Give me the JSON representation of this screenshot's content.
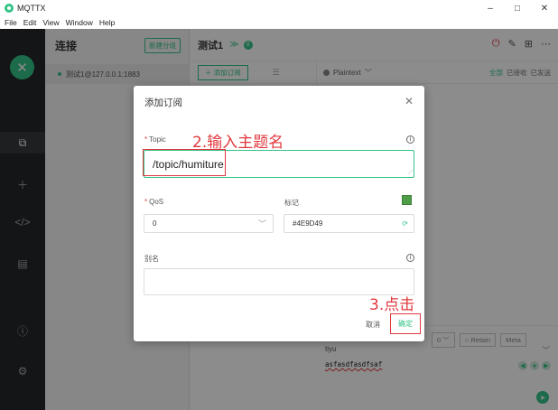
{
  "window": {
    "title": "MQTTX",
    "controls": [
      "–",
      "□",
      "✕"
    ]
  },
  "menu": [
    "File",
    "Edit",
    "View",
    "Window",
    "Help"
  ],
  "sidebar": {
    "logo_text": "✕",
    "nav_icons": [
      "copy-icon",
      "plus-icon",
      "code-icon",
      "log-icon",
      "info-icon",
      "settings-icon"
    ]
  },
  "connections": {
    "title": "连接",
    "new_group": "新建分组",
    "items": [
      {
        "label": "测试1@127.0.0.1:1883"
      }
    ]
  },
  "main": {
    "name": "测试1",
    "badge": "0",
    "add_subscription": "＋ 添加订阅",
    "payload_format": "Plaintext",
    "filters": [
      "全部",
      "已接收",
      "已发送"
    ],
    "qos_value": "0",
    "retain": "Retain",
    "meta": "Meta",
    "compose_topic": "tiyu",
    "compose_payload": "asfasdfasdfsaf"
  },
  "dialog": {
    "title": "添加订阅",
    "topic_label": "Topic",
    "topic_value": "/topic/humiture",
    "qos_label": "QoS",
    "qos_value": "0",
    "mark_label": "标记",
    "mark_value": "#4E9D49",
    "mark_color": "#4e9d49",
    "alias_label": "别名",
    "cancel": "取消",
    "confirm": "确定"
  },
  "annotations": {
    "step2": "2.输入主题名",
    "step3": "3.点击"
  },
  "colors": {
    "accent": "#34c388",
    "danger": "#e0383e",
    "sidebar_bg": "#262729"
  }
}
